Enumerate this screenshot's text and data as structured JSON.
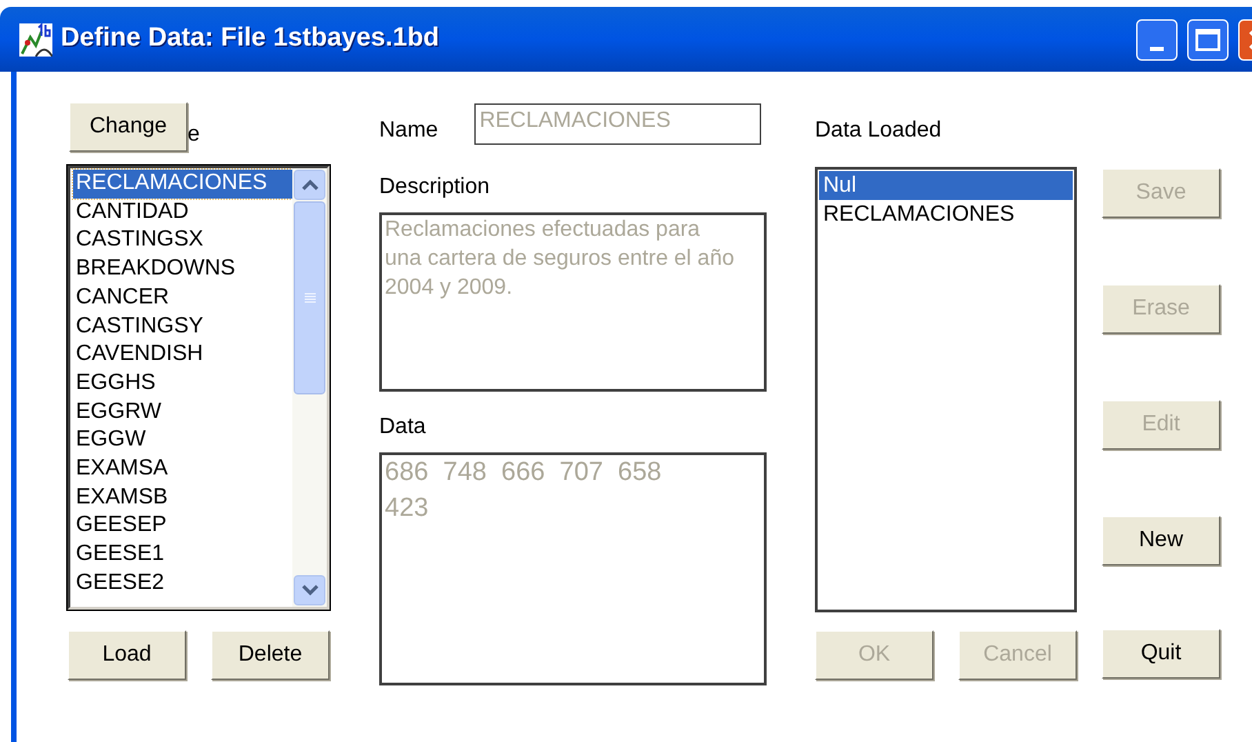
{
  "window": {
    "title": "Define Data: File 1stbayes.1bd"
  },
  "file_panel": {
    "change_button": {
      "label": "Change",
      "disabled": false
    },
    "label_behind": "e",
    "items": [
      {
        "label": "RECLAMACIONES",
        "selected": true
      },
      {
        "label": "CANTIDAD",
        "selected": false
      },
      {
        "label": "CASTINGSX",
        "selected": false
      },
      {
        "label": "BREAKDOWNS",
        "selected": false
      },
      {
        "label": "CANCER",
        "selected": false
      },
      {
        "label": "CASTINGSY",
        "selected": false
      },
      {
        "label": "CAVENDISH",
        "selected": false
      },
      {
        "label": "EGGHS",
        "selected": false
      },
      {
        "label": "EGGRW",
        "selected": false
      },
      {
        "label": "EGGW",
        "selected": false
      },
      {
        "label": "EXAMSA",
        "selected": false
      },
      {
        "label": "EXAMSB",
        "selected": false
      },
      {
        "label": "GEESEP",
        "selected": false
      },
      {
        "label": "GEESE1",
        "selected": false
      },
      {
        "label": "GEESE2",
        "selected": false
      }
    ],
    "buttons": [
      {
        "label": "Load",
        "disabled": false
      },
      {
        "label": "Delete",
        "disabled": false
      }
    ]
  },
  "name": {
    "label": "Name",
    "value": "RECLAMACIONES",
    "disabled": true
  },
  "description": {
    "label": "Description",
    "value": "Reclamaciones efectuadas para una cartera de seguros entre el año 2004 y 2009.",
    "disabled": true
  },
  "data": {
    "label": "Data",
    "value": "686  748  666  707  658\n423",
    "disabled": true
  },
  "data_loaded": {
    "label": "Data Loaded",
    "items": [
      {
        "label": "Nul",
        "selected": true
      },
      {
        "label": "RECLAMACIONES",
        "selected": false
      }
    ],
    "bottom_buttons": [
      {
        "label": "OK",
        "disabled": true
      },
      {
        "label": "Cancel",
        "disabled": true
      }
    ]
  },
  "side_buttons": [
    {
      "label": "Save",
      "disabled": true
    },
    {
      "label": "Erase",
      "disabled": true
    },
    {
      "label": "Edit",
      "disabled": true
    },
    {
      "label": "New",
      "disabled": false
    },
    {
      "label": "Quit",
      "disabled": false
    }
  ]
}
